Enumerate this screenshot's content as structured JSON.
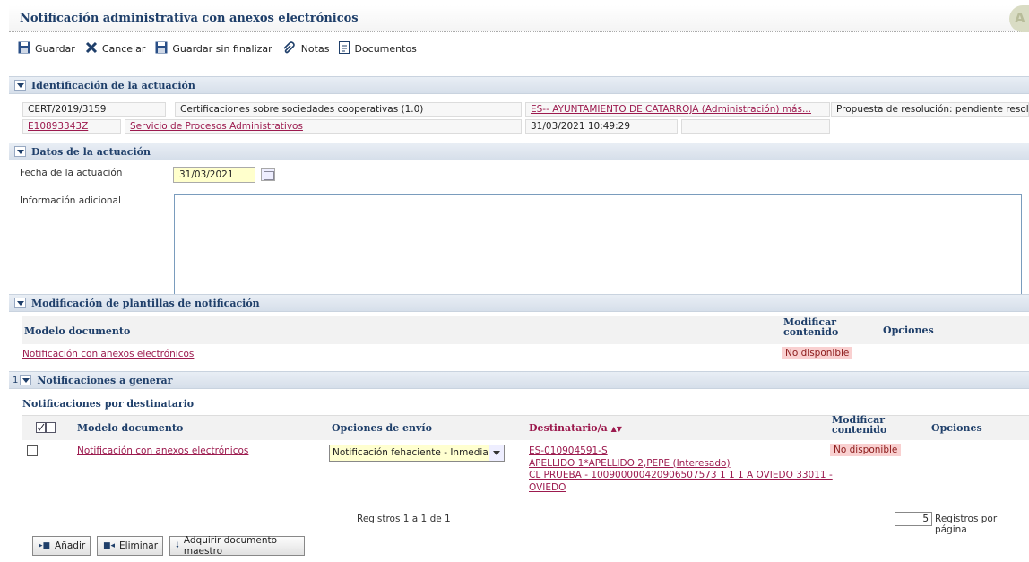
{
  "window": {
    "title": "Notificación administrativa con anexos electrónicos",
    "corner_letter": "A"
  },
  "toolbar": {
    "save": "Guardar",
    "cancel": "Cancelar",
    "save_no_finish": "Guardar sin finalizar",
    "notes": "Notas",
    "documents": "Documentos"
  },
  "identification": {
    "title": "Identificación de la actuación",
    "code": "CERT/2019/3159",
    "procedure": "Certificaciones sobre sociedades cooperativas (1.0)",
    "entity": "ES-- AYUNTAMIENTO DE CATARROJA (Administración) más...",
    "status": "Propuesta de resolución: pendiente resoluc",
    "user_id": "E10893343Z",
    "service": "Servicio de Procesos Administrativos",
    "datetime": "31/03/2021 10:49:29"
  },
  "action_data": {
    "title": "Datos de la actuación",
    "date_label": "Fecha de la actuación",
    "date_value": "31/03/2021",
    "info_label": "Información adicional"
  },
  "templates": {
    "title": "Modificación de plantillas de notificación",
    "col_model": "Modelo documento",
    "col_modify_1": "Modificar",
    "col_modify_2": "contenido",
    "col_options": "Opciones",
    "row_model": "Notificación con anexos electrónicos",
    "row_status": "No disponible"
  },
  "notifications": {
    "count": "1",
    "title": "Notificaciones a generar",
    "subtitle": "Notificaciones por destinatario",
    "col_model": "Modelo documento",
    "col_send": "Opciones de envío",
    "col_recipient": "Destinatario/a",
    "col_modify_1": "Modificar",
    "col_modify_2": "contenido",
    "col_options": "Opciones",
    "row_model": "Notificación con anexos electrónicos",
    "row_send_option": "Notificación fehaciente - Inmediato",
    "recipient_line1": "ES-010904591-S",
    "recipient_line2": "APELLIDO 1*APELLIDO 2,PEPE (Interesado)",
    "recipient_line3": "CL PRUEBA - 100900000420906507573 1 1 1 A OVIEDO 33011 -",
    "recipient_line4": "OVIEDO",
    "row_status": "No disponible",
    "records_text": "Registros 1 a 1 de 1",
    "per_page_value": "5",
    "per_page_label": "Registros por página"
  },
  "buttons": {
    "add": "Añadir",
    "delete": "Eliminar",
    "acquire": "Adquirir documento maestro"
  }
}
